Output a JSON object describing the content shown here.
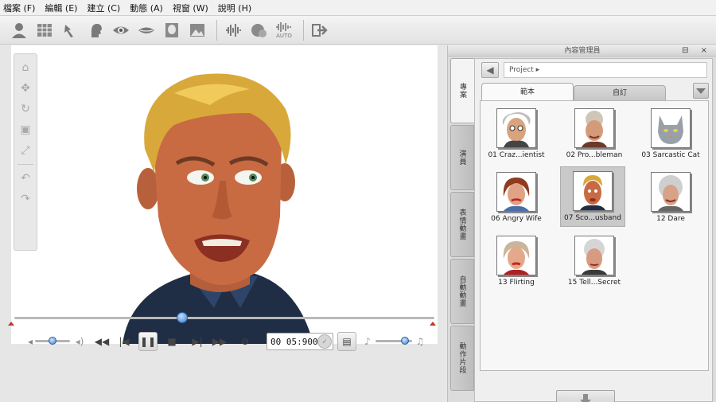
{
  "menu": {
    "items": [
      "檔案 (F)",
      "編輯 (E)",
      "建立 (C)",
      "動態 (A)",
      "視窗 (W)",
      "說明 (H)"
    ]
  },
  "toolbar": {
    "icons": [
      "actor-icon",
      "grid-icon",
      "hand-icon",
      "head-icon",
      "eye-icon",
      "mouth-icon",
      "face-fit-icon",
      "image-icon",
      "audio-wave-icon",
      "puppet-icon",
      "auto-lipsync-icon",
      "export-icon"
    ],
    "auto_label": "AUTO"
  },
  "viewer": {
    "nav_icons": [
      "home-icon",
      "move-icon",
      "rotate-icon",
      "zoom-icon",
      "fit-icon",
      "undo-icon",
      "redo-icon"
    ]
  },
  "timeline": {
    "progress": 0.4
  },
  "playback": {
    "volume_level": 0.5,
    "speed_level": 0.8,
    "timecode": "00 05:900"
  },
  "panel": {
    "title": "內容管理員",
    "title_icons": "⊟ ×",
    "side_tabs": [
      "專案",
      "演員",
      "表情動畫",
      "自動動畫",
      "動作片段"
    ],
    "back_label": "◀",
    "path": "Project ▸",
    "tabs": [
      "範本",
      "自訂"
    ],
    "items": [
      {
        "label": "01 Craz...ientist"
      },
      {
        "label": "02 Pro...bleman"
      },
      {
        "label": "03 Sarcastic Cat"
      },
      {
        "label": "06 Angry Wife"
      },
      {
        "label": "07 Sco...usband",
        "selected": true
      },
      {
        "label": "12 Dare"
      },
      {
        "label": "13 Flirting"
      },
      {
        "label": "15 Tell...Secret"
      }
    ],
    "import_label": "import"
  }
}
